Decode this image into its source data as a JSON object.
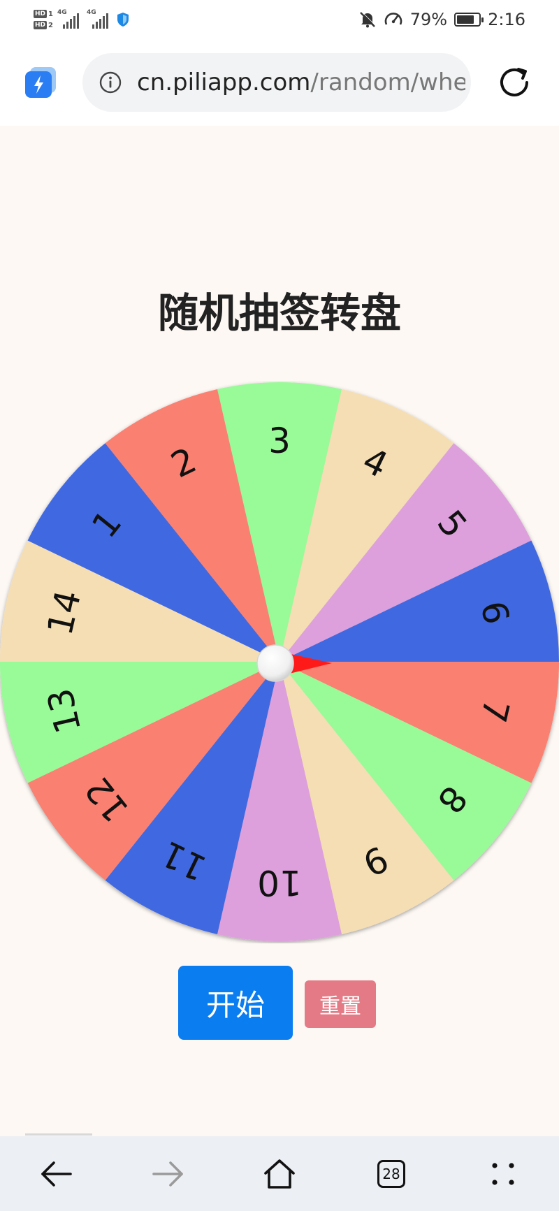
{
  "status_bar": {
    "hd1": "HD",
    "hd1_num": "1",
    "hd2": "HD",
    "hd2_num": "2",
    "signal1_label": "4G",
    "signal2_label": "4G",
    "battery_percent": "79%",
    "battery_level": 0.79,
    "time": "2:16"
  },
  "browser": {
    "url_host": "cn.piliapp.com",
    "url_path": "/random/whee",
    "tab_count": "28"
  },
  "page": {
    "title": "随机抽签转盘",
    "start_button": "开始",
    "reset_button": "重置"
  },
  "wheel": {
    "colors": {
      "red": "#fa8072",
      "green": "#98fb98",
      "wheat": "#f5deb3",
      "plum": "#dda0dd",
      "blue": "#4169e1",
      "pointer": "#ff1a1a"
    },
    "segments": [
      {
        "label": "3",
        "color": "green"
      },
      {
        "label": "4",
        "color": "wheat"
      },
      {
        "label": "5",
        "color": "plum"
      },
      {
        "label": "6",
        "color": "blue"
      },
      {
        "label": "7",
        "color": "red"
      },
      {
        "label": "8",
        "color": "green"
      },
      {
        "label": "9",
        "color": "wheat"
      },
      {
        "label": "10",
        "color": "plum"
      },
      {
        "label": "11",
        "color": "blue"
      },
      {
        "label": "12",
        "color": "red"
      },
      {
        "label": "13",
        "color": "green"
      },
      {
        "label": "14",
        "color": "wheat"
      },
      {
        "label": "1",
        "color": "blue"
      },
      {
        "label": "2",
        "color": "red"
      }
    ]
  },
  "icons": {
    "app": "browser-bolt-icon",
    "info": "info-icon",
    "reload": "reload-icon",
    "back": "back-arrow-icon",
    "forward": "forward-arrow-icon",
    "home": "home-icon",
    "tabs": "tabs-icon",
    "menu": "menu-dots-icon"
  }
}
